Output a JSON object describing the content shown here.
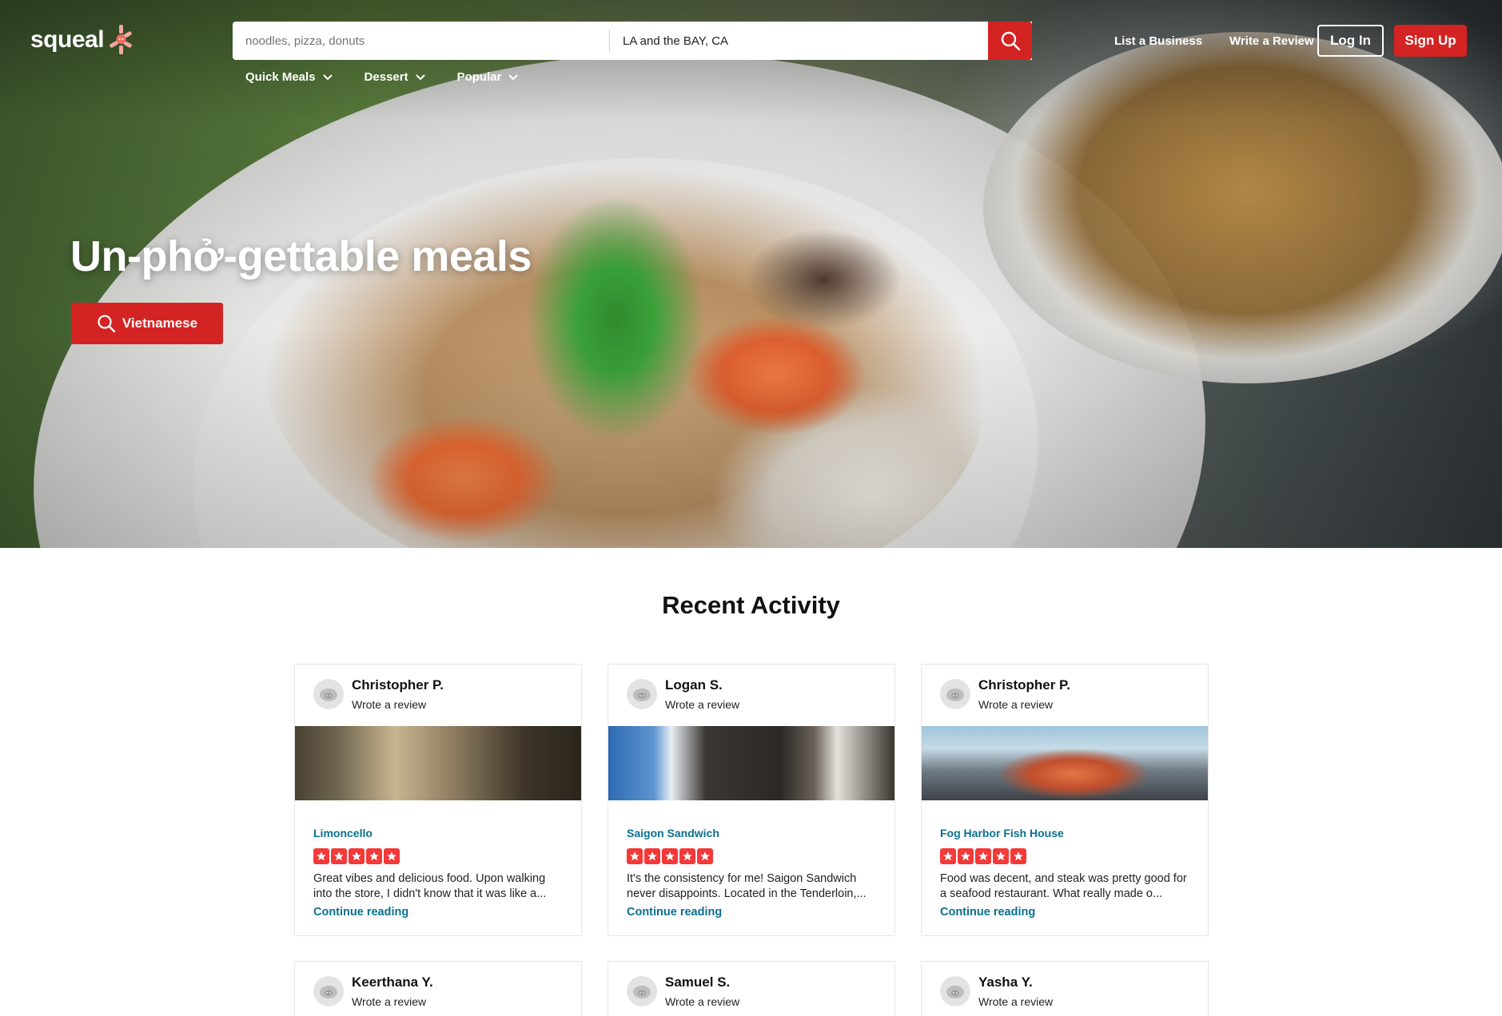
{
  "brand": {
    "name": "squeal",
    "accent": "#d32323"
  },
  "search": {
    "find_placeholder": "noodles, pizza, donuts",
    "near_value": "LA and the BAY, CA",
    "submit_icon": "search-icon"
  },
  "nav": {
    "list_business": "List a Business",
    "write_review": "Write a Review",
    "login": "Log In",
    "signup": "Sign Up"
  },
  "categories": [
    {
      "label": "Quick Meals",
      "icon": "chevron-down-icon"
    },
    {
      "label": "Dessert",
      "icon": "chevron-down-icon"
    },
    {
      "label": "Popular",
      "icon": "chevron-down-icon"
    }
  ],
  "hero": {
    "title": "Un-phở-gettable meals",
    "cta_label": "Vietnamese",
    "cta_icon": "search-icon"
  },
  "recent_activity": {
    "title": "Recent Activity",
    "cards": [
      {
        "user": "Christopher P.",
        "action": "Wrote a review",
        "business": "Limoncello",
        "rating": 5,
        "excerpt": "Great vibes and delicious food. Upon walking into the store, I didn't know that it was like a...",
        "continue": "Continue reading"
      },
      {
        "user": "Logan S.",
        "action": "Wrote a review",
        "business": "Saigon Sandwich",
        "rating": 5,
        "excerpt": "It's the consistency for me! Saigon Sandwich never disappoints. Located in the Tenderloin,...",
        "continue": "Continue reading"
      },
      {
        "user": "Christopher P.",
        "action": "Wrote a review",
        "business": "Fog Harbor Fish House",
        "rating": 5,
        "excerpt": "Food was decent, and steak was pretty good for a seafood restaurant. What really made o...",
        "continue": "Continue reading"
      },
      {
        "user": "Keerthana Y.",
        "action": "Wrote a review"
      },
      {
        "user": "Samuel S.",
        "action": "Wrote a review"
      },
      {
        "user": "Yasha Y.",
        "action": "Wrote a review"
      }
    ]
  },
  "colors": {
    "link": "#0a7090",
    "star": "#f43939",
    "button_red": "#d32323"
  }
}
